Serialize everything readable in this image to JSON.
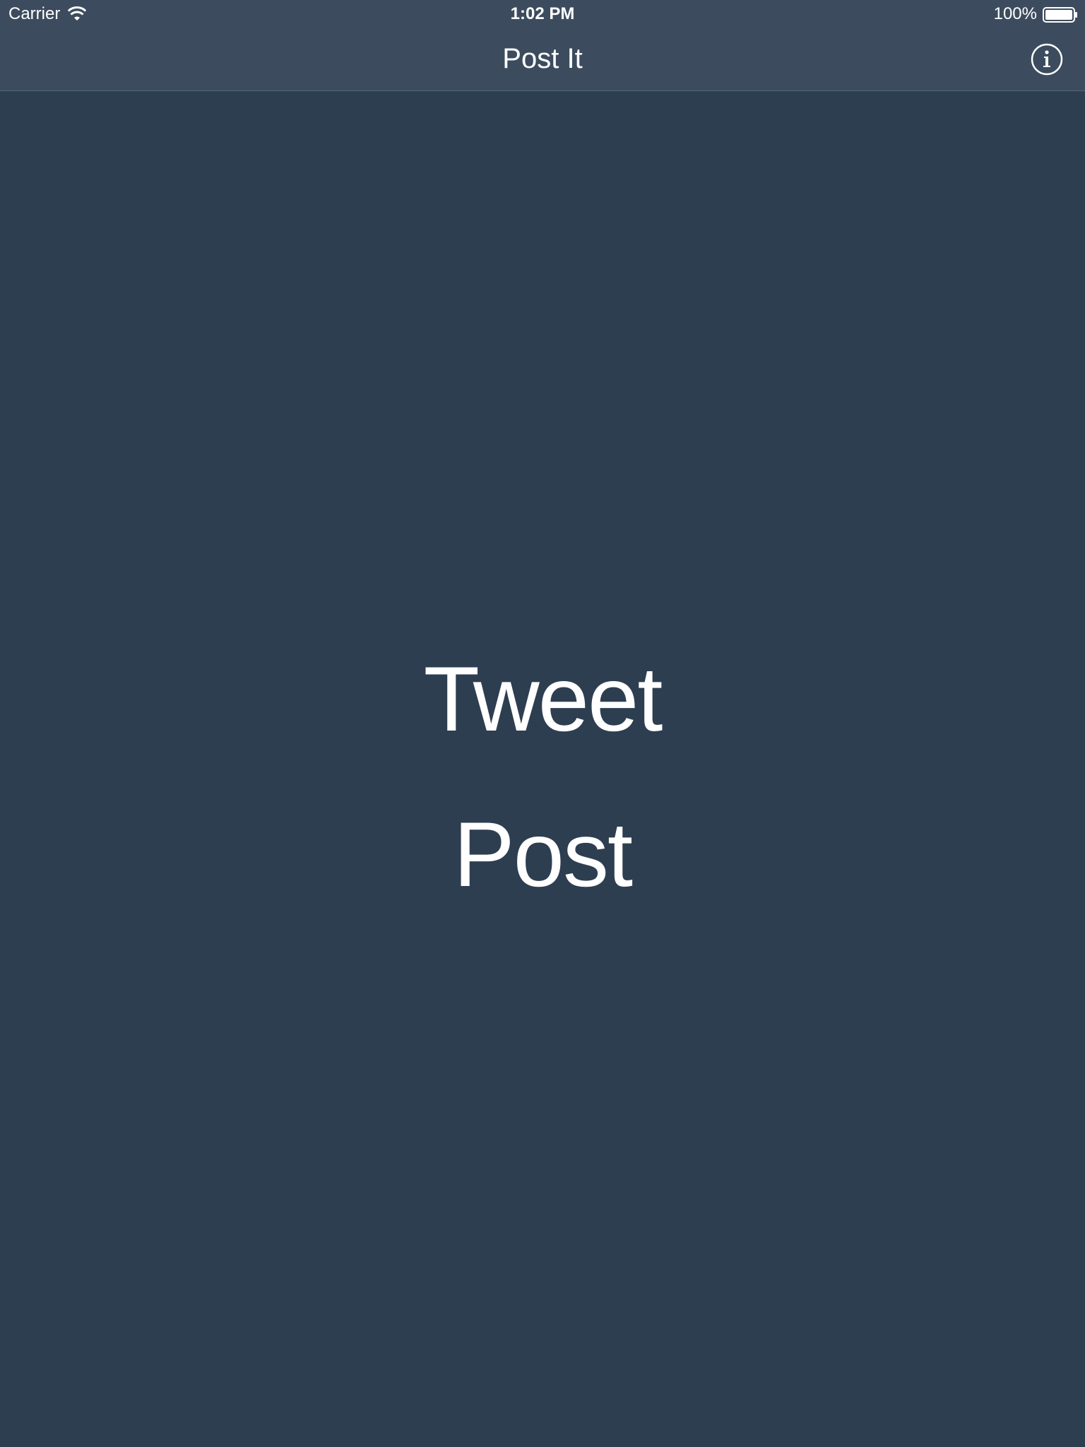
{
  "status_bar": {
    "carrier": "Carrier",
    "time": "1:02 PM",
    "battery_percent": "100%",
    "icons": [
      "wifi-icon",
      "battery-icon"
    ]
  },
  "nav_bar": {
    "title": "Post It",
    "info_icon": "info-icon"
  },
  "main": {
    "tweet_label": "Tweet",
    "post_label": "Post"
  },
  "colors": {
    "background": "#2e3e51",
    "nav_background": "#3c4c5e",
    "text": "#ffffff"
  }
}
